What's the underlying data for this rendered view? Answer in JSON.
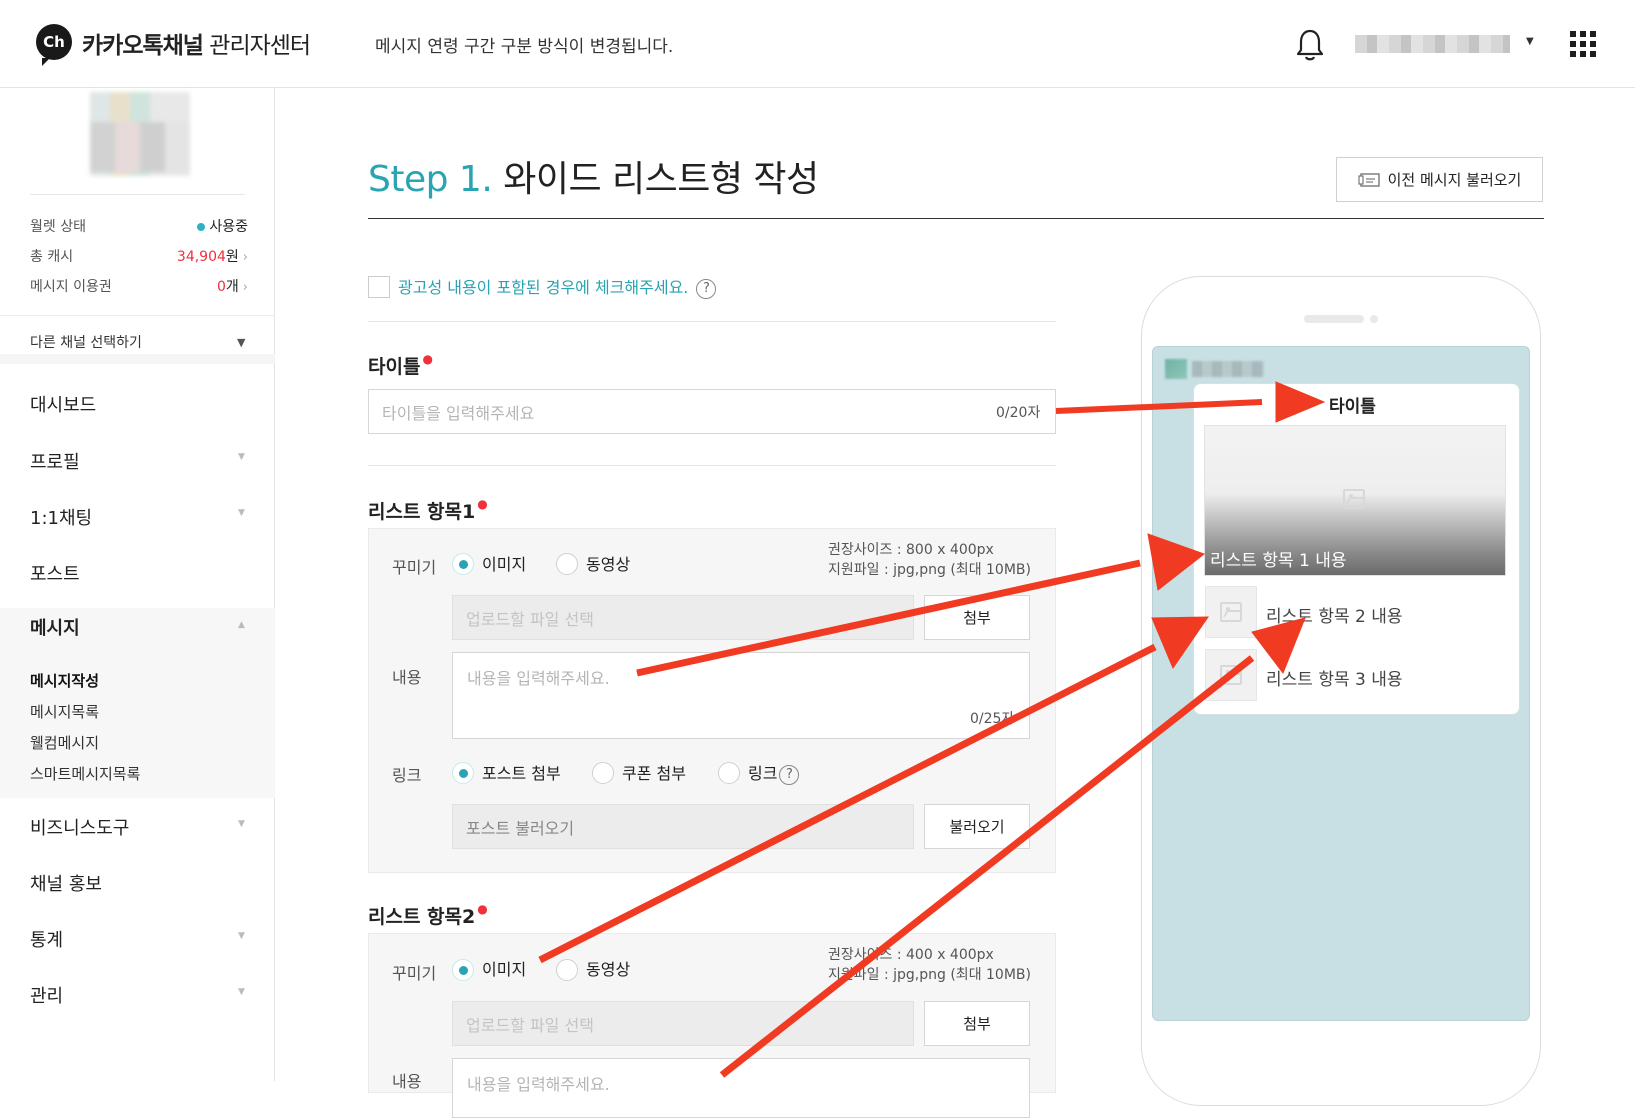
{
  "header": {
    "logo_badge": "Ch",
    "logo_brand": "카카오톡채널",
    "logo_suffix": " 관리자센터",
    "notice": "메시지 연령 구간 구분 방식이 변경됩니다.",
    "icons": [
      "bell-icon",
      "apps-grid-icon"
    ]
  },
  "sidebar": {
    "stats": [
      {
        "label": "월렛 상태",
        "value": "사용중"
      },
      {
        "label": "총 캐시",
        "value": "34,904",
        "unit": "원"
      },
      {
        "label": "메시지 이용권",
        "value": "0",
        "unit": "개"
      }
    ],
    "channel_select": "다른 채널 선택하기",
    "nav": [
      "대시보드",
      "프로필",
      "1:1채팅",
      "포스트",
      "메시지",
      "비즈니스도구",
      "채널 홍보",
      "통계",
      "관리"
    ],
    "message_sub": [
      "메시지작성",
      "메시지목록",
      "웰컴메시지",
      "스마트메시지목록"
    ]
  },
  "main": {
    "step_prefix": "Step 1.",
    "step_title": " 와이드 리스트형 작성",
    "prev_button": "이전 메시지 불러오기",
    "ad_checkbox_label": "광고성 내용이 포함된 경우에 체크해주세요.",
    "help_glyph": "?",
    "title_label": "타이틀",
    "title_placeholder": "타이틀을 입력해주세요",
    "title_counter": "0/20자",
    "item1": {
      "label": "리스트 항목1",
      "decor_label": "꾸미기",
      "radio_image": "이미지",
      "radio_video": "동영상",
      "hint_size": "권장사이즈 : 800 x 400px",
      "hint_file": "지원파일 : jpg,png (최대 10MB)",
      "file_placeholder": "업로드할 파일 선택",
      "attach_button": "첨부",
      "content_label": "내용",
      "content_placeholder": "내용을 입력해주세요.",
      "content_counter": "0/25자",
      "link_label": "링크",
      "link_post": "포스트 첨부",
      "link_coupon": "쿠폰 첨부",
      "link_link": "링크",
      "post_placeholder": "포스트 불러오기",
      "load_button": "불러오기"
    },
    "item2": {
      "label": "리스트 항목2",
      "decor_label": "꾸미기",
      "radio_image": "이미지",
      "radio_video": "동영상",
      "hint_size": "권장사이즈 : 400 x 400px",
      "hint_file": "지원파일 : jpg,png (최대 10MB)",
      "file_placeholder": "업로드할 파일 선택",
      "attach_button": "첨부",
      "content_label": "내용",
      "content_placeholder": "내용을 입력해주세요."
    }
  },
  "preview": {
    "title": "타이틀",
    "item1": "리스트 항목 1 내용",
    "item2": "리스트 항목 2 내용",
    "item3": "리스트 항목 3 내용"
  },
  "colors": {
    "accent": "#2aa3b2",
    "required": "#f0303a",
    "annotation_arrow": "#f03a22",
    "preview_bg": "#c8e0e4"
  }
}
